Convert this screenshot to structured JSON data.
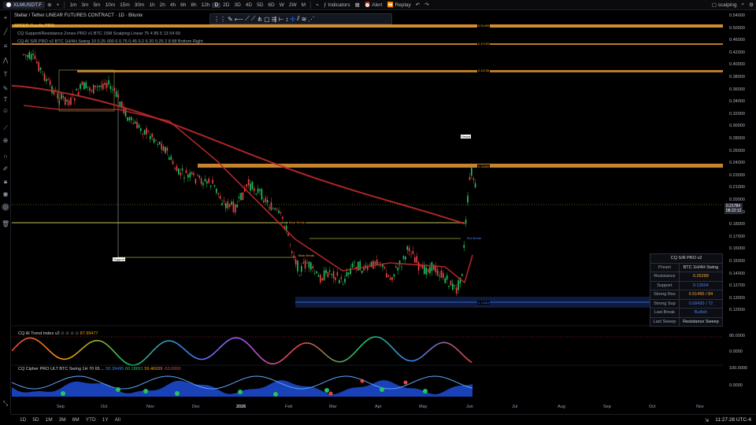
{
  "topbar": {
    "symbol": "XLMUSDT.F",
    "timeframes": [
      "1m",
      "3m",
      "5m",
      "10m",
      "15m",
      "30m",
      "1h",
      "2h",
      "4h",
      "6h",
      "8h",
      "12h",
      "D",
      "2D",
      "3D",
      "4D",
      "5D",
      "6D",
      "W",
      "2W",
      "M"
    ],
    "active_timeframe": "D",
    "indicators_label": "Indicators",
    "alert_label": "Alert",
    "replay_label": "Replay",
    "layout_name": "scalping"
  },
  "chart": {
    "title": "Stellar / Tether LINEAR FUTURES CONTRACT · 1D · Bitunix",
    "overlay_labels": [
      "SPEED Candle PRO",
      "CQ Support/Resistance Zones PRO v1 BTC 15M Scalping Linear 75 4 85 5 13 54 69",
      "CQ AI S/R PRO v2 BTC 1H/4H Swing 10 0.25 900 6 0.75 0.45 0.2 6 20 0.25 2 8 88 Bottom Right"
    ],
    "current_price": "0.21784",
    "countdown": "08:22:12",
    "level_labels": [
      "0.51495",
      "0.47199",
      "0.41135",
      "0.26289",
      "0.13604"
    ],
    "annotations": [
      "Bear Break",
      "Bear Break",
      "Bull Break",
      "Support",
      "Resist"
    ],
    "price_ticks": [
      "0.54000",
      "0.50000",
      "0.46000",
      "0.42000",
      "0.40000",
      "0.38000",
      "0.36000",
      "0.34000",
      "0.32000",
      "0.30000",
      "0.28000",
      "0.26000",
      "0.24000",
      "0.23000",
      "0.21000",
      "0.20000",
      "0.19000",
      "0.18000",
      "0.17000",
      "0.16000",
      "0.15000",
      "0.14000",
      "0.13700",
      "0.13000",
      "0.12500"
    ],
    "date_ticks": [
      "Sep",
      "Oct",
      "Nov",
      "Dec",
      "2026",
      "Feb",
      "Mar",
      "Apr",
      "May",
      "Jun",
      "Jul",
      "Aug",
      "Sep",
      "Oct",
      "Nov"
    ]
  },
  "sr_table": {
    "title": "CQ S/R PRO v2",
    "rows": [
      {
        "k": "Preset",
        "v": "BTC 1H/4H Swing",
        "c": "#d1d4dc"
      },
      {
        "k": "Resistance",
        "v": "0.26289",
        "c": "#f7a53a"
      },
      {
        "k": "Support",
        "v": "0.13604",
        "c": "#4c7df0"
      },
      {
        "k": "Strong Res",
        "v": "0.51495 / 84",
        "c": "#f7a53a"
      },
      {
        "k": "Strong Sup",
        "v": "0.08430 / 72",
        "c": "#4c7df0"
      },
      {
        "k": "Last Break",
        "v": "Bullish",
        "c": "#4c7df0"
      },
      {
        "k": "Last Sweep",
        "v": "Resistance Sweep",
        "c": "#d1d4dc"
      }
    ]
  },
  "trend_pane": {
    "label": "CQ AI Trend Index v2",
    "value": "87.99477",
    "ticks": [
      "80.0000",
      "0.0000"
    ]
  },
  "cipher_pane": {
    "label": "CQ Cipher PRO ULT BTC Swing 1H 70 65 ...",
    "values": [
      "50.39495",
      "60.18651",
      "59.46939",
      "-53.0000"
    ],
    "ticks": [
      "100.0000",
      "0.0000"
    ]
  },
  "bottombar": {
    "ranges": [
      "1D",
      "5D",
      "1M",
      "3M",
      "6M",
      "YTD",
      "1Y",
      "All"
    ],
    "clock": "11:27:28 UTC-4"
  },
  "colors": {
    "bull": "#22c55e",
    "bear": "#ef4444",
    "orange": "#f7a53a",
    "blue": "#3b82f6",
    "ma": "#c02a2a"
  }
}
